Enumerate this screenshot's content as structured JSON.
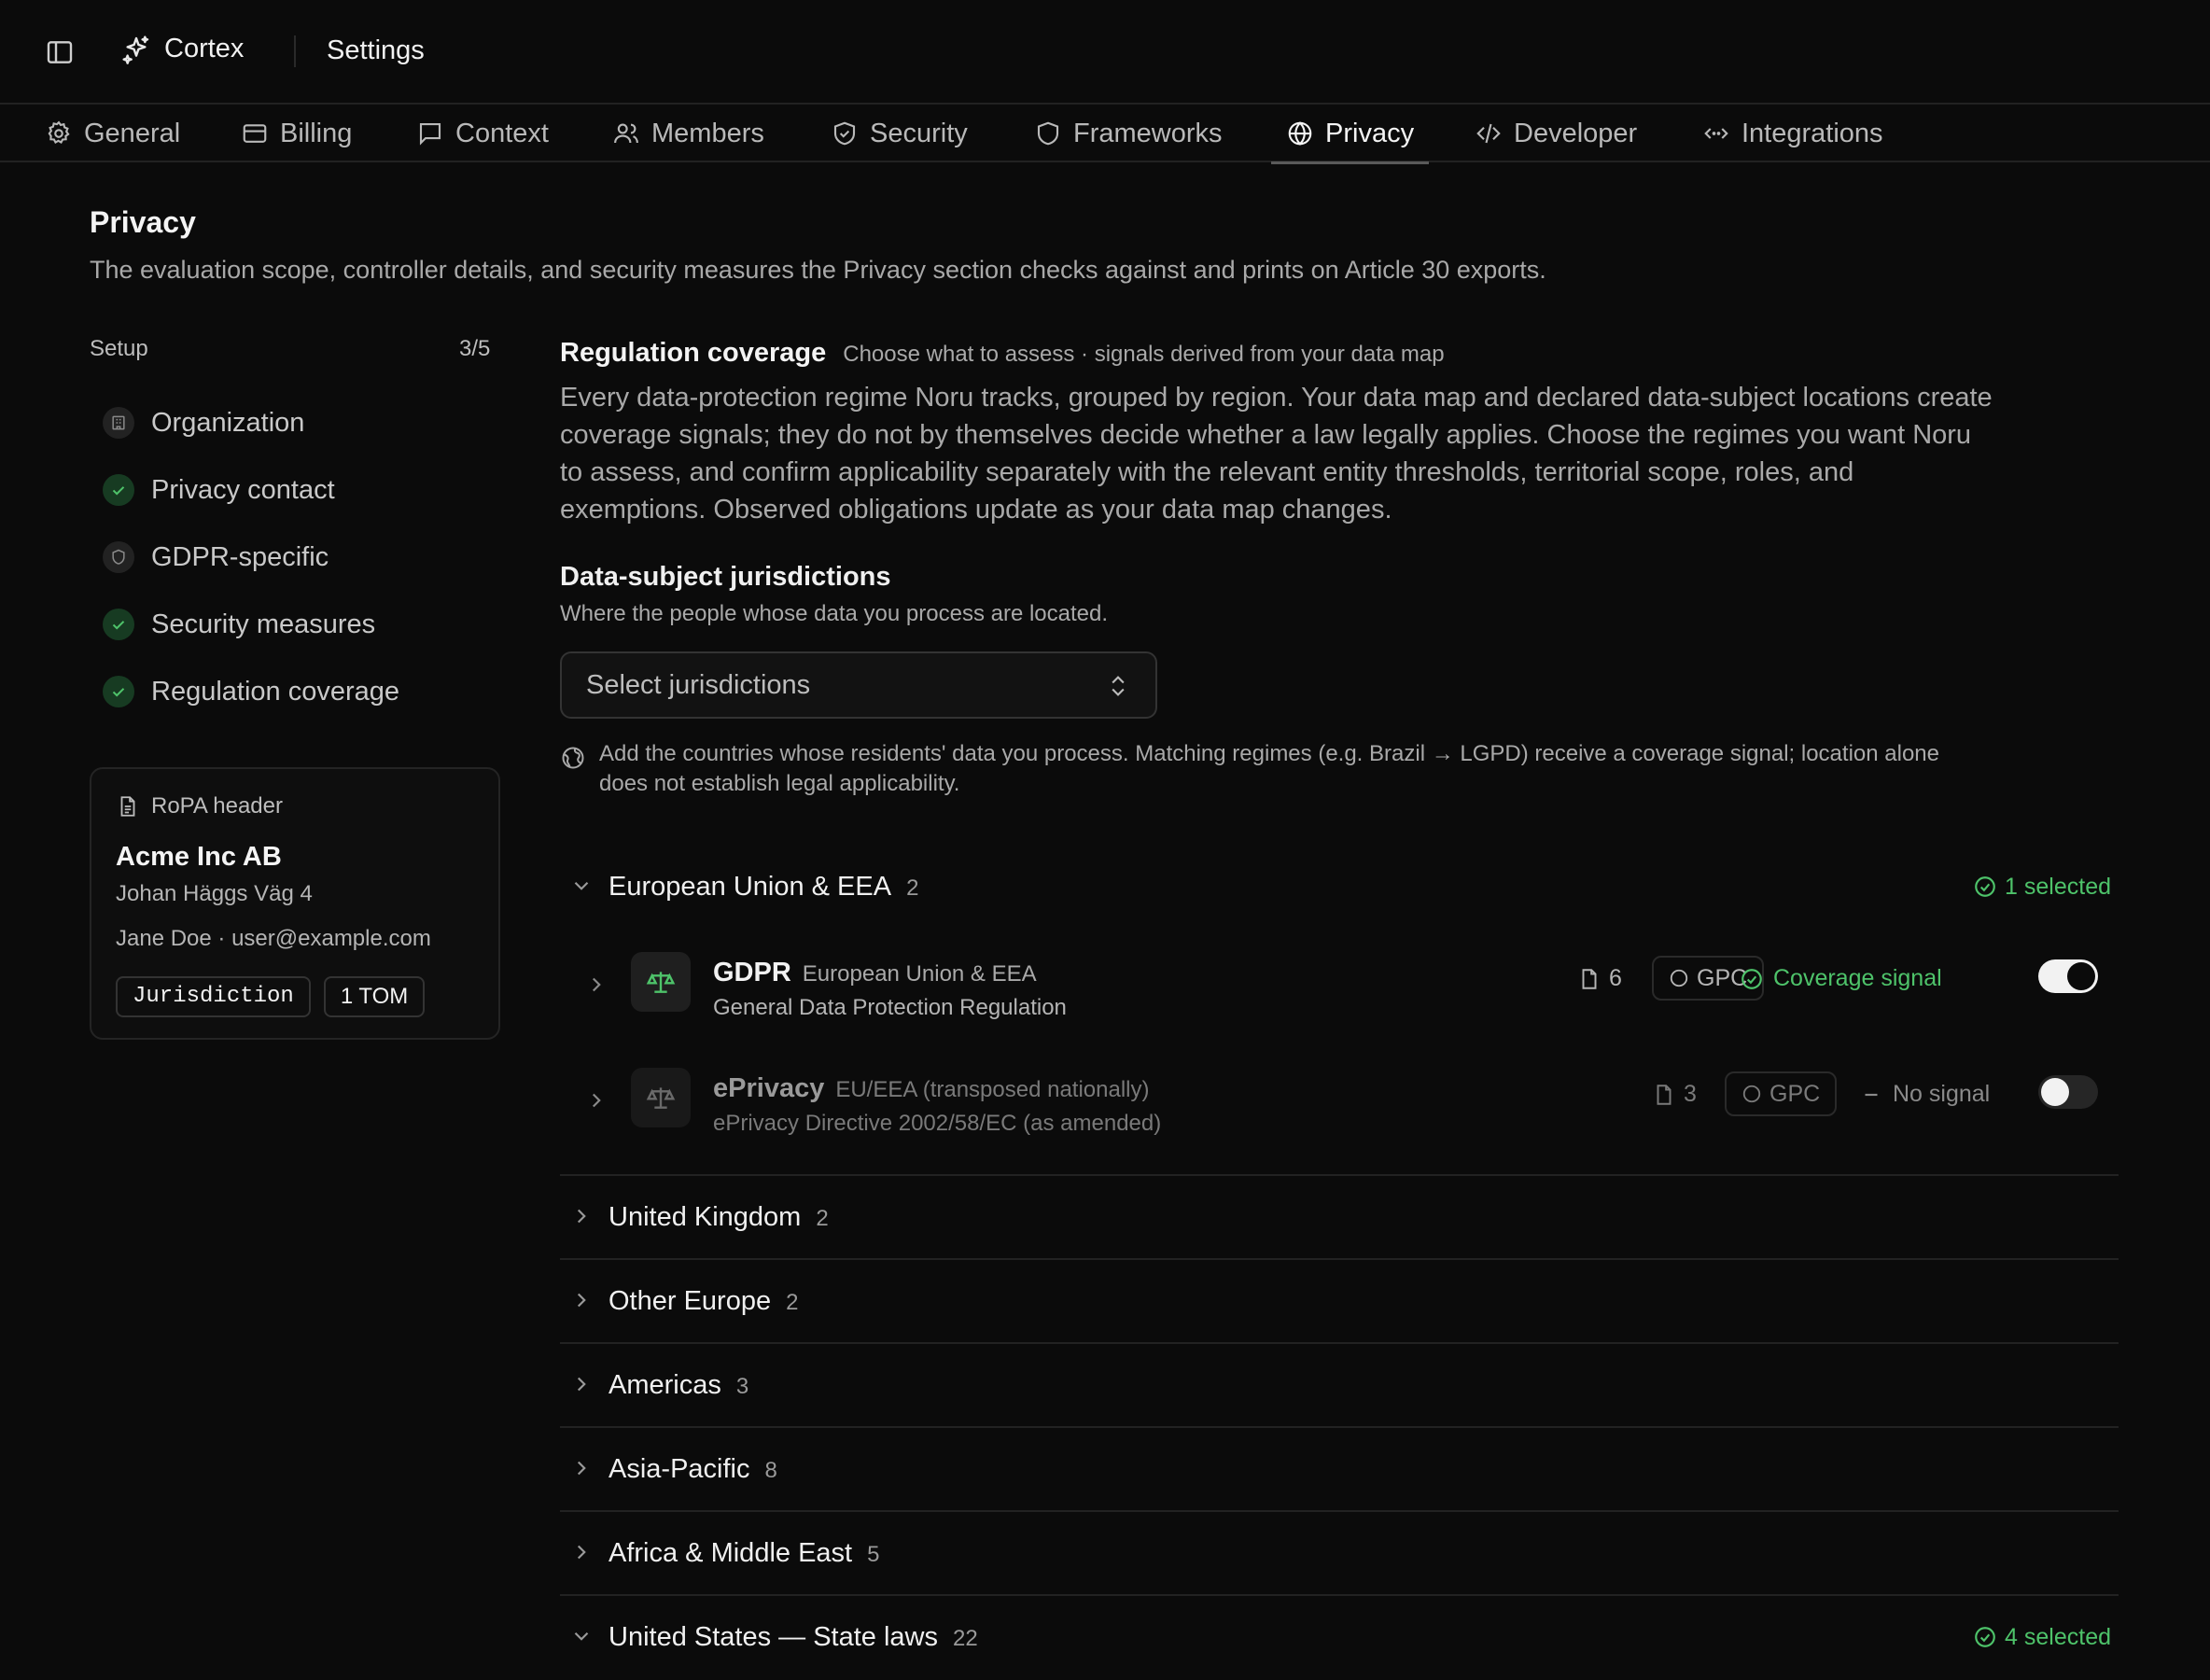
{
  "topbar": {
    "brand": "Cortex",
    "crumb": "Settings"
  },
  "tabs": [
    {
      "label": "General",
      "icon": "gear-icon"
    },
    {
      "label": "Billing",
      "icon": "credit-card-icon"
    },
    {
      "label": "Context",
      "icon": "message-square-icon"
    },
    {
      "label": "Members",
      "icon": "users-icon"
    },
    {
      "label": "Security",
      "icon": "shield-check-icon"
    },
    {
      "label": "Frameworks",
      "icon": "shield-icon"
    },
    {
      "label": "Privacy",
      "icon": "globe-icon",
      "active": true
    },
    {
      "label": "Developer",
      "icon": "code-icon"
    },
    {
      "label": "Integrations",
      "icon": "code-brackets-icon"
    }
  ],
  "page": {
    "title": "Privacy",
    "description": "The evaluation scope, controller details, and security measures the Privacy section checks against and prints on Article 30 exports."
  },
  "setup": {
    "label": "Setup",
    "count": "3/5",
    "steps": [
      {
        "label": "Organization",
        "status": "todo",
        "icon": "building-icon"
      },
      {
        "label": "Privacy contact",
        "status": "done",
        "icon": "check-icon"
      },
      {
        "label": "GDPR-specific",
        "status": "todo",
        "icon": "shield-icon"
      },
      {
        "label": "Security measures",
        "status": "done",
        "icon": "check-icon"
      },
      {
        "label": "Regulation coverage",
        "status": "done",
        "icon": "check-icon"
      }
    ]
  },
  "ropa": {
    "header": "RoPA header",
    "org": "Acme Inc AB",
    "address": "Johan Häggs Väg 4",
    "contact": "Jane Doe · user@example.com",
    "tags": [
      "Jurisdiction",
      "1 TOM"
    ]
  },
  "coverage": {
    "title": "Regulation coverage",
    "subtitle": "Choose what to assess · signals derived from your data map",
    "description": "Every data-protection regime Noru tracks, grouped by region. Your data map and declared data-subject locations create coverage signals; they do not by themselves decide whether a law legally applies. Choose the regimes you want Noru to assess, and confirm applicability separately with the relevant entity thresholds, territorial scope, roles, and exemptions. Observed obligations update as your data map changes."
  },
  "jurisdictions": {
    "title": "Data-subject jurisdictions",
    "subtitle": "Where the people whose data you process are located.",
    "placeholder": "Select jurisdictions",
    "hint": "Add the countries whose residents' data you process. Matching regimes (e.g. Brazil → LGPD) receive a coverage signal; location alone does not establish legal applicability."
  },
  "groups": [
    {
      "name": "European Union & EEA",
      "count": "2",
      "expanded": true,
      "selected": "1 selected"
    },
    {
      "name": "United Kingdom",
      "count": "2",
      "expanded": false
    },
    {
      "name": "Other Europe",
      "count": "2",
      "expanded": false
    },
    {
      "name": "Americas",
      "count": "3",
      "expanded": false
    },
    {
      "name": "Asia-Pacific",
      "count": "8",
      "expanded": false
    },
    {
      "name": "Africa & Middle East",
      "count": "5",
      "expanded": false
    },
    {
      "name": "United States — State laws",
      "count": "22",
      "expanded": true,
      "selected": "4 selected"
    }
  ],
  "regulations": [
    {
      "name": "GDPR",
      "region": "European Union & EEA",
      "full": "General Data Protection Regulation",
      "docs": "6",
      "gpc": "GPC",
      "signal": "Coverage signal",
      "signal_color": "#4ec36a",
      "enabled": true
    },
    {
      "name": "ePrivacy",
      "region": "EU/EEA (transposed nationally)",
      "full": "ePrivacy Directive 2002/58/EC (as amended)",
      "docs": "3",
      "gpc": "GPC",
      "signal": "No signal",
      "signal_color": "#8a8a8a",
      "enabled": false
    }
  ],
  "colors": {
    "accent_green": "#4ec36a",
    "background": "#0b0b0b"
  }
}
